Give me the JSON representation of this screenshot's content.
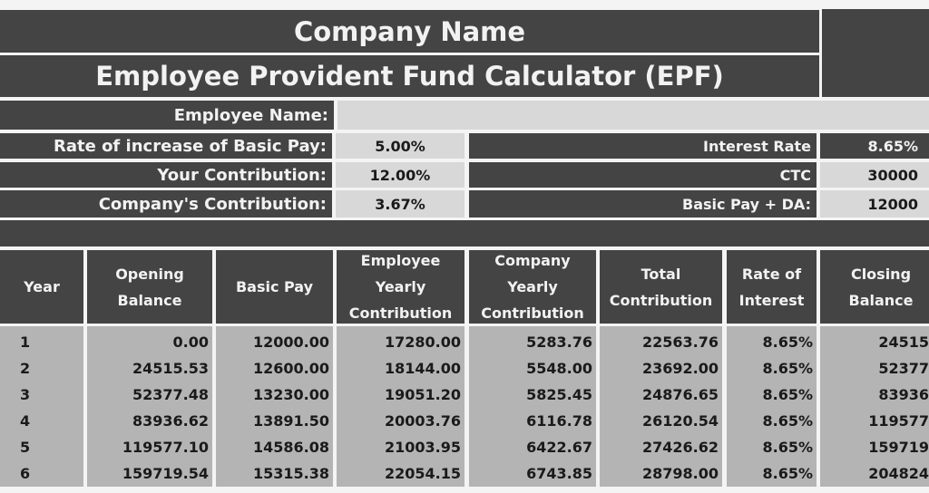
{
  "header": {
    "company_name": "Company Name",
    "title": "Employee Provident Fund Calculator (EPF)"
  },
  "inputs": {
    "employee_name_label": "Employee Name:",
    "employee_name_value": "",
    "rate_increase_label": "Rate of increase of Basic Pay:",
    "rate_increase_value": "5.00%",
    "your_contribution_label": "Your Contribution:",
    "your_contribution_value": "12.00%",
    "company_contribution_label": "Company's Contribution:",
    "company_contribution_value": "3.67%",
    "interest_rate_label": "Interest Rate",
    "interest_rate_value": "8.65%",
    "ctc_label": "CTC",
    "ctc_value": "30000",
    "basic_pay_da_label": "Basic Pay + DA:",
    "basic_pay_da_value": "12000"
  },
  "table": {
    "headers": {
      "year": [
        "Year"
      ],
      "opening_balance": [
        "Opening",
        "Balance"
      ],
      "basic_pay": [
        "Basic Pay"
      ],
      "employee_yearly": [
        "Employee",
        "Yearly",
        "Contribution"
      ],
      "company_yearly": [
        "Company",
        "Yearly",
        "Contribution"
      ],
      "total_contribution": [
        "Total",
        "Contribution"
      ],
      "rate_of_interest": [
        "Rate of",
        "Interest"
      ],
      "closing_balance": [
        "Closing",
        "Balance"
      ]
    },
    "rows": [
      {
        "year": "1",
        "opening": "0.00",
        "basic": "12000.00",
        "employee": "17280.00",
        "company": "5283.76",
        "total": "22563.76",
        "rate": "8.65%",
        "closing": "24515"
      },
      {
        "year": "2",
        "opening": "24515.53",
        "basic": "12600.00",
        "employee": "18144.00",
        "company": "5548.00",
        "total": "23692.00",
        "rate": "8.65%",
        "closing": "52377"
      },
      {
        "year": "3",
        "opening": "52377.48",
        "basic": "13230.00",
        "employee": "19051.20",
        "company": "5825.45",
        "total": "24876.65",
        "rate": "8.65%",
        "closing": "83936"
      },
      {
        "year": "4",
        "opening": "83936.62",
        "basic": "13891.50",
        "employee": "20003.76",
        "company": "6116.78",
        "total": "26120.54",
        "rate": "8.65%",
        "closing": "119577"
      },
      {
        "year": "5",
        "opening": "119577.10",
        "basic": "14586.08",
        "employee": "21003.95",
        "company": "6422.67",
        "total": "27426.62",
        "rate": "8.65%",
        "closing": "159719"
      },
      {
        "year": "6",
        "opening": "159719.54",
        "basic": "15315.38",
        "employee": "22054.15",
        "company": "6743.85",
        "total": "28798.00",
        "rate": "8.65%",
        "closing": "204824"
      }
    ]
  }
}
